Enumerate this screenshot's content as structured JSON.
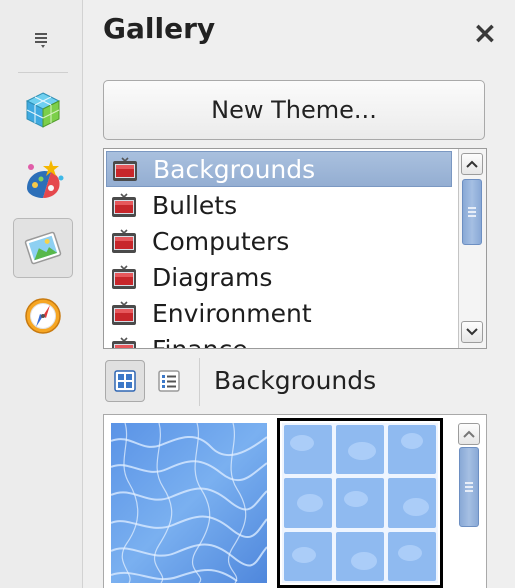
{
  "deck": {
    "title": "Gallery",
    "close_glyph": "×"
  },
  "tabbar": {
    "menu_icon": "sidebar-menu-icon",
    "tabs": [
      {
        "id": "properties",
        "icon": "properties-cube-icon",
        "active": false
      },
      {
        "id": "styles",
        "icon": "styles-palette-icon",
        "active": false
      },
      {
        "id": "gallery",
        "icon": "gallery-picture-icon",
        "active": true
      },
      {
        "id": "navigator",
        "icon": "navigator-compass-icon",
        "active": false
      }
    ]
  },
  "new_theme_label": "New Theme...",
  "themes": {
    "items": [
      "Backgrounds",
      "Bullets",
      "Computers",
      "Diagrams",
      "Environment",
      "Finance"
    ],
    "selected": "Backgrounds",
    "scroll_fraction": 0.0
  },
  "view": {
    "icon_view_icon": "icon-view-icon",
    "detail_view_icon": "detailed-view-icon",
    "active": "icon",
    "current_theme": "Backgrounds"
  },
  "preview": {
    "items": [
      {
        "name": "water-texture",
        "selected": false
      },
      {
        "name": "blue-tiles",
        "selected": true
      }
    ]
  },
  "colors": {
    "selection": "#9db6da",
    "scroll_thumb": "#8fb0dc"
  }
}
